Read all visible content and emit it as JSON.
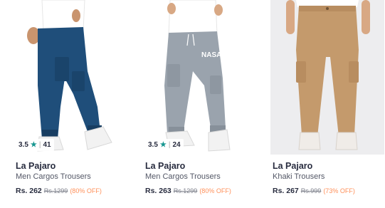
{
  "products": [
    {
      "brand": "La Pajaro",
      "name": "Men Cargos Trousers",
      "price": "Rs. 262",
      "mrp": "Rs.1299",
      "discount": "(80% OFF)",
      "rating": "3.5",
      "rating_count": "41",
      "colors": {
        "pants": "#1f4e7a",
        "shirt": "#ffffff",
        "shoe": "#f2f2f2",
        "skin": "#c9946e"
      }
    },
    {
      "brand": "La Pajaro",
      "name": "Men Cargos Trousers",
      "price": "Rs. 263",
      "mrp": "Rs.1299",
      "discount": "(80% OFF)",
      "rating": "3.5",
      "rating_count": "24",
      "print_text": "NASA",
      "colors": {
        "pants": "#9aa3ad",
        "shirt": "#ffffff",
        "shoe": "#f2f2f2",
        "skin": "#d8a884"
      }
    },
    {
      "brand": "La Pajaro",
      "name": "Khaki Trousers",
      "price": "Rs. 267",
      "mrp": "Rs.999",
      "discount": "(73% OFF)",
      "colors": {
        "pants": "#c49a6c",
        "shirt": "#ffffff",
        "shoe": "#f0ece8",
        "skin": "#d8a884"
      }
    }
  ],
  "accent": {
    "star": "#14958f",
    "discount": "#ff905a"
  }
}
